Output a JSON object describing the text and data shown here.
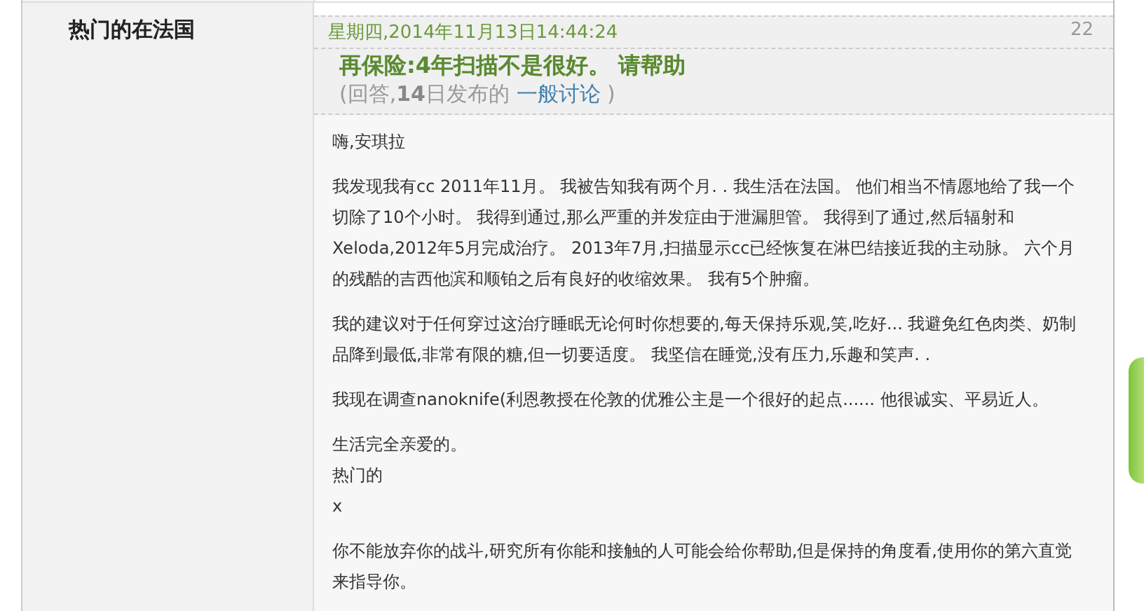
{
  "author": {
    "name": "热门的在法国"
  },
  "post": {
    "date": "星期四,2014年11月13日14:44:24",
    "number": "22",
    "title": "再保险:**4**年扫描不是很好。 请帮助",
    "subtitle_before": "(回答,**14**日发布的",
    "subtitle_link": "一般讨论",
    "subtitle_after": ")",
    "paragraphs": [
      {
        "kind": "para",
        "lines": [
          "嗨,安琪拉"
        ]
      },
      {
        "kind": "para",
        "lines": [
          "我发现我有cc 2011年11月。 我被告知我有两个月. . 我生活在法国。 他们相当不情愿地给了我一个切除了10个小时。 我得到通过,那么严重的并发症由于泄漏胆管。 我得到了通过,然后辐射和Xeloda,2012年5月完成治疗。 2013年7月,扫描显示cc已经恢复在淋巴结接近我的主动脉。 六个月的残酷的吉西他滨和顺铂之后有良好的收缩效果。 我有5个肿瘤。"
        ]
      },
      {
        "kind": "para",
        "lines": [
          "我的建议对于任何穿过这治疗睡眠无论何时你想要的,每天保持乐观,笑,吃好... 我避免红色肉类、奶制品降到最低,非常有限的糖,但一切要适度。 我坚信在睡觉,没有压力,乐趣和笑声. ."
        ]
      },
      {
        "kind": "para",
        "lines": [
          "我现在调查nanoknife(利恩教授在伦敦的优雅公主是一个很好的起点...... 他很诚实、平易近人。"
        ]
      },
      {
        "kind": "signature",
        "lines": [
          "生活完全亲爱的。",
          "热门的",
          "x"
        ]
      },
      {
        "kind": "para",
        "lines": [
          "你不能放弃你的战斗,研究所有你能和接触的人可能会给你帮助,但是保持的角度看,使用你的第六直觉来指导你。"
        ]
      }
    ]
  }
}
